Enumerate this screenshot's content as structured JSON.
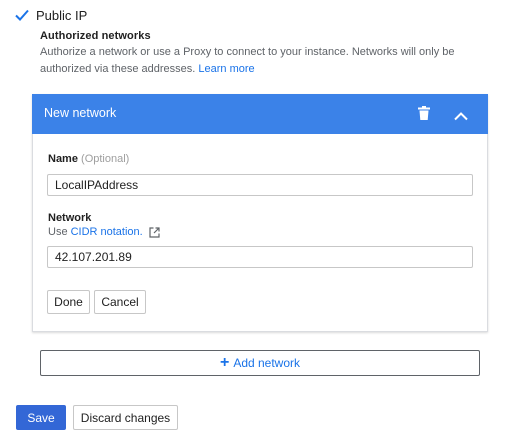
{
  "public_ip": {
    "label": "Public IP",
    "checked": true
  },
  "authorized_networks": {
    "title": "Authorized networks",
    "description": "Authorize a network or use a Proxy to connect to your instance. Networks will only be authorized via these addresses.",
    "learn_more": "Learn more"
  },
  "network_card": {
    "title": "New network",
    "icons": {
      "delete": "trash-icon",
      "collapse": "chevron-up-icon"
    },
    "name_field": {
      "label": "Name",
      "optional": "(Optional)",
      "value": "LocalIPAddress"
    },
    "network_field": {
      "label": "Network",
      "hint_prefix": "Use",
      "hint_link": "CIDR notation.",
      "hint_icon": "external-link-icon",
      "value": "42.107.201.89"
    },
    "done_label": "Done",
    "cancel_label": "Cancel"
  },
  "add_network": {
    "icon": "plus-icon",
    "label": "Add network"
  },
  "footer": {
    "save_label": "Save",
    "discard_label": "Discard changes"
  },
  "colors": {
    "accent": "#3b82e8",
    "save_button": "#3367d6",
    "link": "#1a73e8"
  }
}
